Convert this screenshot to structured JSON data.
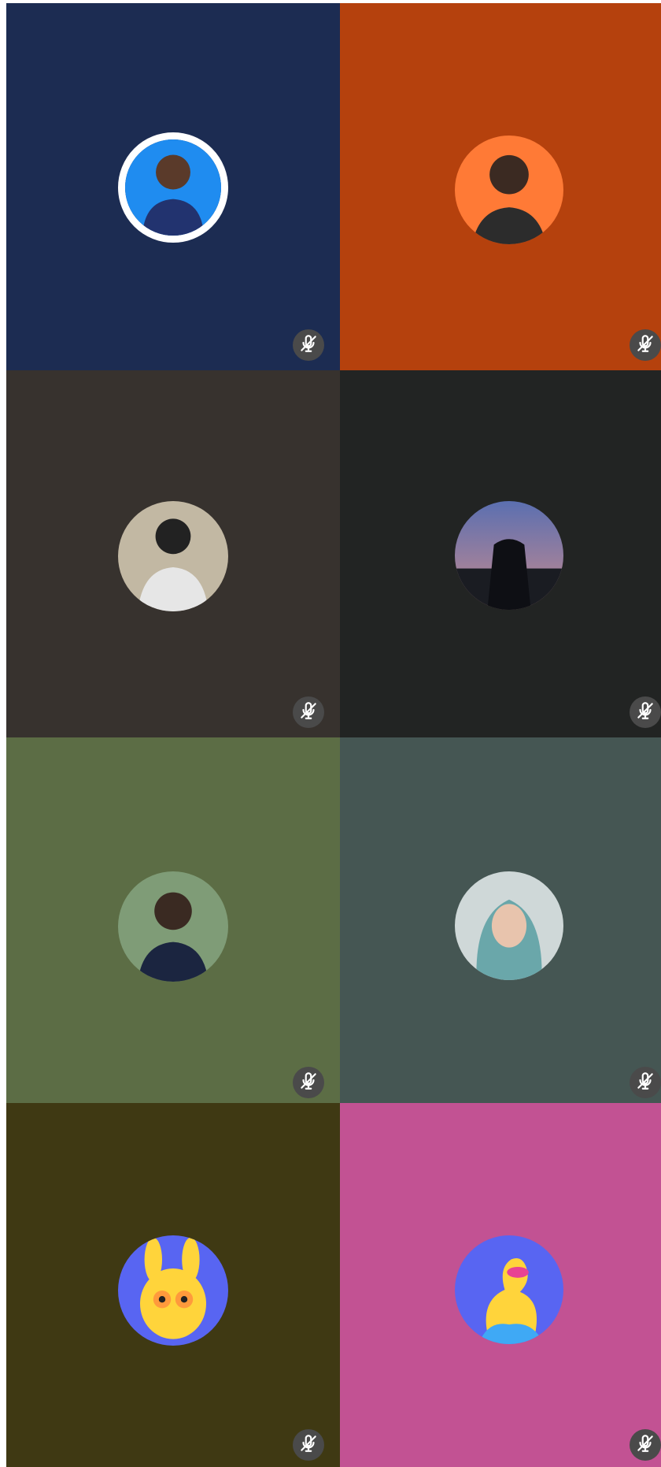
{
  "participants": [
    {
      "tile_color": "#1c2c52",
      "avatar_bg": "#1f8cf0",
      "avatar_ring": "#ffffff",
      "muted": true,
      "mute_icon": "mic-off-icon"
    },
    {
      "tile_color": "#b5410d",
      "avatar_bg": "#ff7a36",
      "muted": true,
      "mute_icon": "mic-off-icon"
    },
    {
      "tile_color": "#37322e",
      "avatar_bg": "#c2b8a3",
      "muted": true,
      "mute_icon": "mic-off-icon"
    },
    {
      "tile_color": "#222423",
      "avatar_bg": "#6f6aa0",
      "muted": true,
      "mute_icon": "mic-off-icon"
    },
    {
      "tile_color": "#5c6d45",
      "avatar_bg": "#7f9c77",
      "muted": true,
      "mute_icon": "mic-off-icon"
    },
    {
      "tile_color": "#455653",
      "avatar_bg": "#cfd8d8",
      "muted": true,
      "mute_icon": "mic-off-icon"
    },
    {
      "tile_color": "#3f3913",
      "avatar_bg": "#5865f2",
      "muted": true,
      "mute_icon": "mic-off-icon"
    },
    {
      "tile_color": "#c25293",
      "avatar_bg": "#5865f2",
      "muted": true,
      "mute_icon": "mic-off-icon"
    }
  ],
  "mute_badge_color": "#4a4a4a",
  "mute_icon_color": "#ffffff"
}
